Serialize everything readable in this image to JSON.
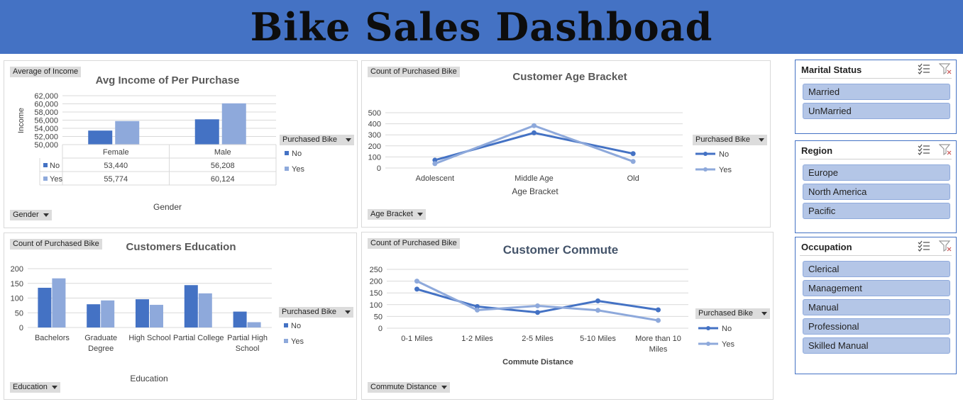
{
  "header": {
    "title": "Bike Sales Dashboad"
  },
  "colors": {
    "no": "#4472c4",
    "yes": "#8ea9db",
    "grid": "#d9d9d9",
    "banner": "#4472c4"
  },
  "legend": {
    "title": "Purchased Bike",
    "no": "No",
    "yes": "Yes"
  },
  "chart_data": [
    {
      "type": "bar",
      "id": "income",
      "title": "Avg Income of Per Purchase",
      "value_field": "Average of Income",
      "axis_field": "Gender",
      "xlabel": "Gender",
      "ylabel": "Income",
      "categories": [
        "Female",
        "Male"
      ],
      "ylim": [
        50000,
        62000
      ],
      "yticks": [
        "62,000",
        "60,000",
        "58,000",
        "56,000",
        "54,000",
        "52,000",
        "50,000"
      ],
      "series": [
        {
          "name": "No",
          "values": [
            53440,
            56208
          ],
          "labels": [
            "53,440",
            "56,208"
          ]
        },
        {
          "name": "Yes",
          "values": [
            55774,
            60124
          ],
          "labels": [
            "55,774",
            "60,124"
          ]
        }
      ]
    },
    {
      "type": "line",
      "id": "age",
      "title": "Customer Age Bracket",
      "value_field": "Count of Purchased Bike",
      "axis_field": "Age Bracket",
      "xlabel": "Age Bracket",
      "categories": [
        "Adolescent",
        "Middle Age",
        "Old"
      ],
      "ylim": [
        0,
        500
      ],
      "yticks": [
        "500",
        "400",
        "300",
        "200",
        "100",
        "0"
      ],
      "series": [
        {
          "name": "No",
          "values": [
            71,
            318,
            130
          ]
        },
        {
          "name": "Yes",
          "values": [
            39,
            383,
            59
          ]
        }
      ]
    },
    {
      "type": "bar",
      "id": "education",
      "title": "Customers Education",
      "value_field": "Count of Purchased Bike",
      "axis_field": "Education",
      "xlabel": "Education",
      "categories": [
        [
          "Bachelors"
        ],
        [
          "Graduate",
          "Degree"
        ],
        [
          "High School"
        ],
        [
          "Partial College"
        ],
        [
          "Partial High",
          "School"
        ]
      ],
      "ylim": [
        0,
        200
      ],
      "yticks": [
        "200",
        "150",
        "100",
        "50",
        "0"
      ],
      "series": [
        {
          "name": "No",
          "values": [
            135,
            79,
            96,
            144,
            54
          ]
        },
        {
          "name": "Yes",
          "values": [
            167,
            92,
            77,
            116,
            18
          ]
        }
      ]
    },
    {
      "type": "line",
      "id": "commute",
      "title": "Customer Commute",
      "value_field": "Count of Purchased Bike",
      "axis_field": "Commute Distance",
      "xlabel": "Commute Distance",
      "categories": [
        [
          "0-1 Miles"
        ],
        [
          "1-2 Miles"
        ],
        [
          "2-5 Miles"
        ],
        [
          "5-10 Miles"
        ],
        [
          "More than 10",
          "Miles"
        ]
      ],
      "ylim": [
        0,
        250
      ],
      "yticks": [
        "250",
        "200",
        "150",
        "100",
        "50",
        "0"
      ],
      "series": [
        {
          "name": "No",
          "values": [
            166,
            92,
            67,
            116,
            78
          ]
        },
        {
          "name": "Yes",
          "values": [
            200,
            77,
            95,
            76,
            33
          ]
        }
      ]
    }
  ],
  "slicers": {
    "marital": {
      "title": "Marital Status",
      "items": [
        "Married",
        "UnMarried"
      ]
    },
    "region": {
      "title": "Region",
      "items": [
        "Europe",
        "North America",
        "Pacific"
      ]
    },
    "occupation": {
      "title": "Occupation",
      "items": [
        "Clerical",
        "Management",
        "Manual",
        "Professional",
        "Skilled Manual"
      ]
    }
  }
}
